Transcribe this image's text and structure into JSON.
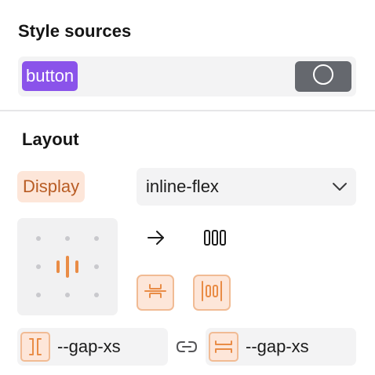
{
  "style_sources": {
    "title": "Style sources",
    "token_label": "button"
  },
  "layout": {
    "title": "Layout",
    "display": {
      "label": "Display",
      "value": "inline-flex"
    },
    "gap": {
      "column_value": "--gap-xs",
      "row_value": "--gap-xs"
    }
  },
  "colors": {
    "token_bg": "#8a53ea",
    "accent_text": "#b85c24",
    "accent_bg": "#fde6d9",
    "accent_icon": "#e98c46",
    "state_button_bg": "#65686e"
  },
  "icons": [
    "circle-icon",
    "chevron-down-icon",
    "arrow-right-icon",
    "no-wrap-icon",
    "align-center-icon",
    "justify-center-icon",
    "column-gap-icon",
    "link-icon",
    "row-gap-icon"
  ]
}
